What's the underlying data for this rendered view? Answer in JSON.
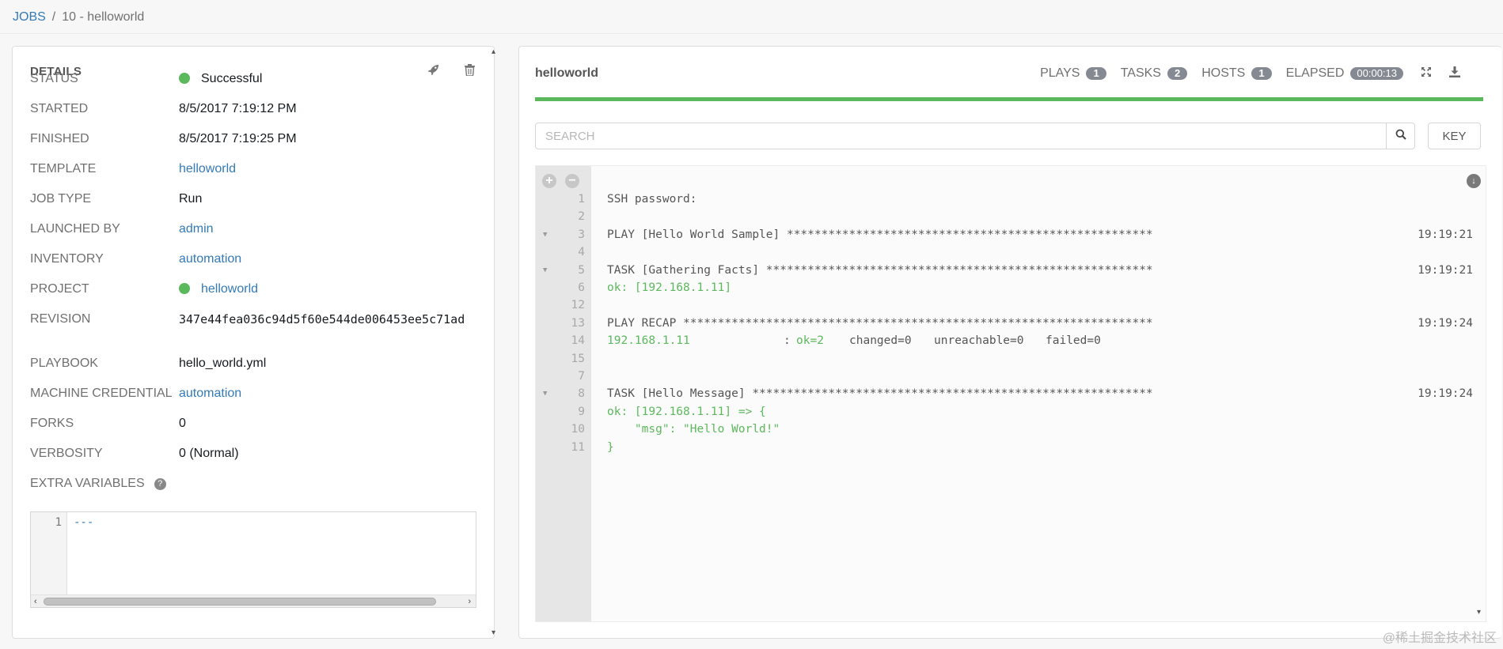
{
  "breadcrumb": {
    "root": "JOBS",
    "separator": "/",
    "current": "10 - helloworld"
  },
  "details": {
    "title": "DETAILS",
    "fields": {
      "status": {
        "label": "STATUS",
        "value": "Successful"
      },
      "started": {
        "label": "STARTED",
        "value": "8/5/2017 7:19:12 PM"
      },
      "finished": {
        "label": "FINISHED",
        "value": "8/5/2017 7:19:25 PM"
      },
      "template": {
        "label": "TEMPLATE",
        "value": "helloworld"
      },
      "job_type": {
        "label": "JOB TYPE",
        "value": "Run"
      },
      "launched_by": {
        "label": "LAUNCHED BY",
        "value": "admin"
      },
      "inventory": {
        "label": "INVENTORY",
        "value": "automation"
      },
      "project": {
        "label": "PROJECT",
        "value": "helloworld"
      },
      "revision": {
        "label": "REVISION",
        "value": "347e44fea036c94d5f60e544de006453ee5c71ad"
      },
      "playbook": {
        "label": "PLAYBOOK",
        "value": "hello_world.yml"
      },
      "machine_credential": {
        "label": "MACHINE CREDENTIAL",
        "value": "automation"
      },
      "forks": {
        "label": "FORKS",
        "value": "0"
      },
      "verbosity": {
        "label": "VERBOSITY",
        "value": "0 (Normal)"
      }
    },
    "extra_variables": {
      "label": "EXTRA VARIABLES",
      "line_number": "1",
      "code": "---"
    }
  },
  "output": {
    "job_name": "helloworld",
    "stats": {
      "plays": {
        "label": "PLAYS",
        "count": "1"
      },
      "tasks": {
        "label": "TASKS",
        "count": "2"
      },
      "hosts": {
        "label": "HOSTS",
        "count": "1"
      },
      "elapsed": {
        "label": "ELAPSED",
        "value": "00:00:13"
      }
    },
    "progress": 1.0,
    "search_placeholder": "SEARCH",
    "key_button": "KEY",
    "lines": [
      {
        "n": "1",
        "text": "SSH password:",
        "ts": "",
        "fold": false,
        "green": false
      },
      {
        "n": "2",
        "text": "",
        "ts": "",
        "fold": false,
        "green": false
      },
      {
        "n": "3",
        "text": "PLAY [Hello World Sample] *****************************************************",
        "ts": "19:19:21",
        "fold": true,
        "green": false
      },
      {
        "n": "4",
        "text": "",
        "ts": "",
        "fold": false,
        "green": false
      },
      {
        "n": "5",
        "text": "TASK [Gathering Facts] ********************************************************",
        "ts": "19:19:21",
        "fold": true,
        "green": false
      },
      {
        "n": "6",
        "text": "ok: [192.168.1.11]",
        "ts": "",
        "fold": false,
        "green": true
      },
      {
        "n": "12",
        "text": "",
        "ts": "",
        "fold": false,
        "green": false
      },
      {
        "n": "13",
        "text": "PLAY RECAP ********************************************************************",
        "ts": "19:19:24",
        "fold": false,
        "green": false
      },
      {
        "n": "14",
        "text": "",
        "ts": "",
        "fold": false,
        "green": false,
        "recap": true
      },
      {
        "n": "15",
        "text": "",
        "ts": "",
        "fold": false,
        "green": false
      },
      {
        "n": "7",
        "text": "",
        "ts": "",
        "fold": false,
        "green": false
      },
      {
        "n": "8",
        "text": "TASK [Hello Message] **********************************************************",
        "ts": "19:19:24",
        "fold": true,
        "green": false
      },
      {
        "n": "9",
        "text": "ok: [192.168.1.11] => {",
        "ts": "",
        "fold": false,
        "green": true
      },
      {
        "n": "10",
        "text": "    \"msg\": \"Hello World!\"",
        "ts": "",
        "fold": false,
        "green": true
      },
      {
        "n": "11",
        "text": "}",
        "ts": "",
        "fold": false,
        "green": true
      }
    ],
    "recap": {
      "host": "192.168.1.11",
      "colon": ":",
      "ok": "ok=2",
      "changed": "changed=0",
      "unreachable": "unreachable=0",
      "failed": "failed=0"
    }
  },
  "watermark": "@稀土掘金技术社区",
  "colors": {
    "success": "#5cb85c",
    "link": "#337ab7",
    "badge": "#848992"
  }
}
